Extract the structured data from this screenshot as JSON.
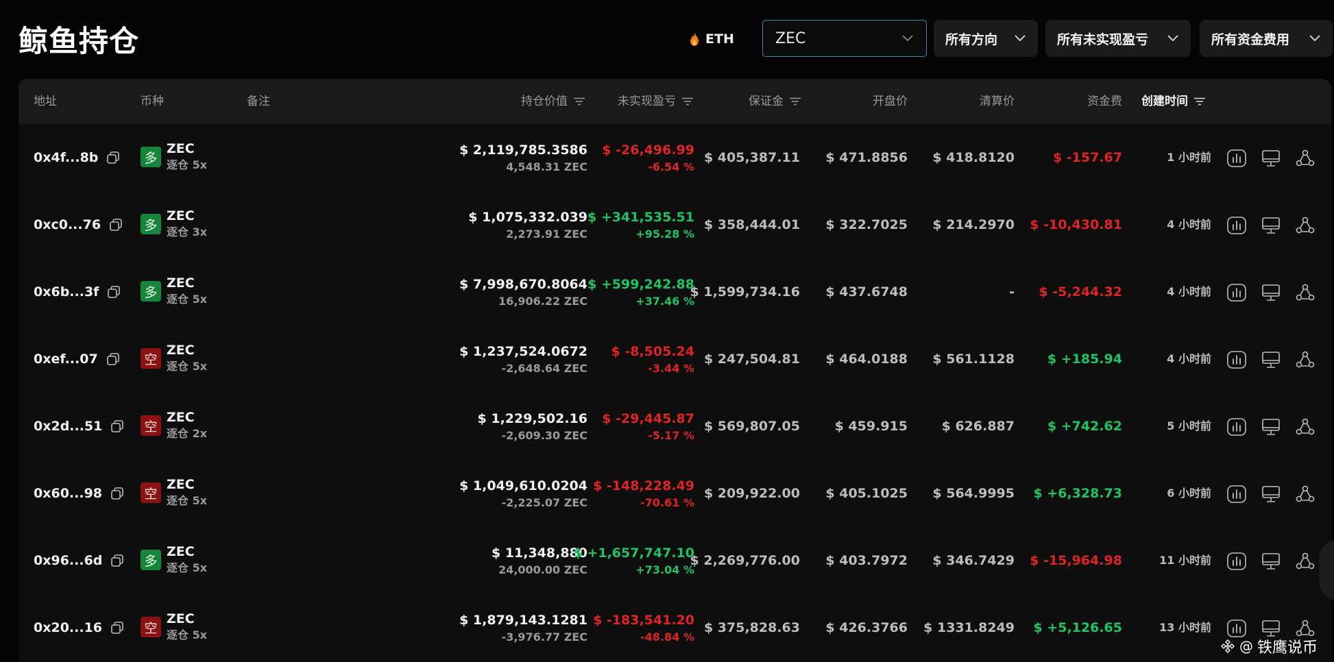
{
  "page": {
    "title": "鲸鱼持仓",
    "eth_label": "ETH",
    "search_value": "ZEC",
    "filters": [
      "所有方向",
      "所有未实现盈亏",
      "所有资金费用"
    ]
  },
  "columns": {
    "address": "地址",
    "coin": "币种",
    "note": "备注",
    "position_value": "持仓价值",
    "unrealized_pnl": "未实现盈亏",
    "margin": "保证金",
    "entry_price": "开盘价",
    "liq_price": "清算价",
    "funding": "资金费",
    "created": "创建时间"
  },
  "rows": [
    {
      "address": "0x4f...8b",
      "side": "多",
      "side_type": "long",
      "coin": "ZEC",
      "leverage": "逐仓 5x",
      "value": "$ 2,119,785.3586",
      "qty": "4,548.31 ZEC",
      "pnl": "$ -26,496.99",
      "pnl_pct": "-6.54 %",
      "pnl_dir": "red",
      "margin": "$ 405,387.11",
      "entry": "$ 471.8856",
      "liq": "$ 418.8120",
      "funding": "$ -157.67",
      "funding_dir": "red",
      "time": "1 小时前"
    },
    {
      "address": "0xc0...76",
      "side": "多",
      "side_type": "long",
      "coin": "ZEC",
      "leverage": "逐仓 3x",
      "value": "$ 1,075,332.039",
      "qty": "2,273.91 ZEC",
      "pnl": "$ +341,535.51",
      "pnl_pct": "+95.28 %",
      "pnl_dir": "green",
      "margin": "$ 358,444.01",
      "entry": "$ 322.7025",
      "liq": "$ 214.2970",
      "funding": "$ -10,430.81",
      "funding_dir": "red",
      "time": "4 小时前"
    },
    {
      "address": "0x6b...3f",
      "side": "多",
      "side_type": "long",
      "coin": "ZEC",
      "leverage": "逐仓 5x",
      "value": "$ 7,998,670.8064",
      "qty": "16,906.22 ZEC",
      "pnl": "$ +599,242.88",
      "pnl_pct": "+37.46 %",
      "pnl_dir": "green",
      "margin": "$ 1,599,734.16",
      "entry": "$ 437.6748",
      "liq": "-",
      "funding": "$ -5,244.32",
      "funding_dir": "red",
      "time": "4 小时前"
    },
    {
      "address": "0xef...07",
      "side": "空",
      "side_type": "short",
      "coin": "ZEC",
      "leverage": "逐仓 5x",
      "value": "$ 1,237,524.0672",
      "qty": "-2,648.64 ZEC",
      "pnl": "$ -8,505.24",
      "pnl_pct": "-3.44 %",
      "pnl_dir": "red",
      "margin": "$ 247,504.81",
      "entry": "$ 464.0188",
      "liq": "$ 561.1128",
      "funding": "$ +185.94",
      "funding_dir": "green",
      "time": "4 小时前"
    },
    {
      "address": "0x2d...51",
      "side": "空",
      "side_type": "short",
      "coin": "ZEC",
      "leverage": "逐仓 2x",
      "value": "$ 1,229,502.16",
      "qty": "-2,609.30 ZEC",
      "pnl": "$ -29,445.87",
      "pnl_pct": "-5.17 %",
      "pnl_dir": "red",
      "margin": "$ 569,807.05",
      "entry": "$ 459.915",
      "liq": "$ 626.887",
      "funding": "$ +742.62",
      "funding_dir": "green",
      "time": "5 小时前"
    },
    {
      "address": "0x60...98",
      "side": "空",
      "side_type": "short",
      "coin": "ZEC",
      "leverage": "逐仓 5x",
      "value": "$ 1,049,610.0204",
      "qty": "-2,225.07 ZEC",
      "pnl": "$ -148,228.49",
      "pnl_pct": "-70.61 %",
      "pnl_dir": "red",
      "margin": "$ 209,922.00",
      "entry": "$ 405.1025",
      "liq": "$ 564.9995",
      "funding": "$ +6,328.73",
      "funding_dir": "green",
      "time": "6 小时前"
    },
    {
      "address": "0x96...6d",
      "side": "多",
      "side_type": "long",
      "coin": "ZEC",
      "leverage": "逐仓 5x",
      "value": "$ 11,348,880",
      "qty": "24,000.00 ZEC",
      "pnl": "$ +1,657,747.10",
      "pnl_pct": "+73.04 %",
      "pnl_dir": "green",
      "margin": "$ 2,269,776.00",
      "entry": "$ 403.7972",
      "liq": "$ 346.7429",
      "funding": "$ -15,964.98",
      "funding_dir": "red",
      "time": "11 小时前"
    },
    {
      "address": "0x20...16",
      "side": "空",
      "side_type": "short",
      "coin": "ZEC",
      "leverage": "逐仓 5x",
      "value": "$ 1,879,143.1281",
      "qty": "-3,976.77 ZEC",
      "pnl": "$ -183,541.20",
      "pnl_pct": "-48.84 %",
      "pnl_dir": "red",
      "margin": "$ 375,828.63",
      "entry": "$ 426.3766",
      "liq": "$ 1331.8249",
      "funding": "$ +5,126.65",
      "funding_dir": "green",
      "time": "13 小时前"
    }
  ],
  "watermark": {
    "at": "@",
    "text": "铁鹰说币"
  },
  "colors": {
    "accent_border": "#3d8fb0",
    "long": "#16853c",
    "short": "#8a1212",
    "loss": "#e02424",
    "gain": "#1ec463"
  },
  "icons": {
    "row_actions": [
      "chart-icon",
      "monitor-icon",
      "share-icon"
    ],
    "copy": "copy-icon",
    "sort": "sort-icon",
    "flame": "flame-icon"
  }
}
